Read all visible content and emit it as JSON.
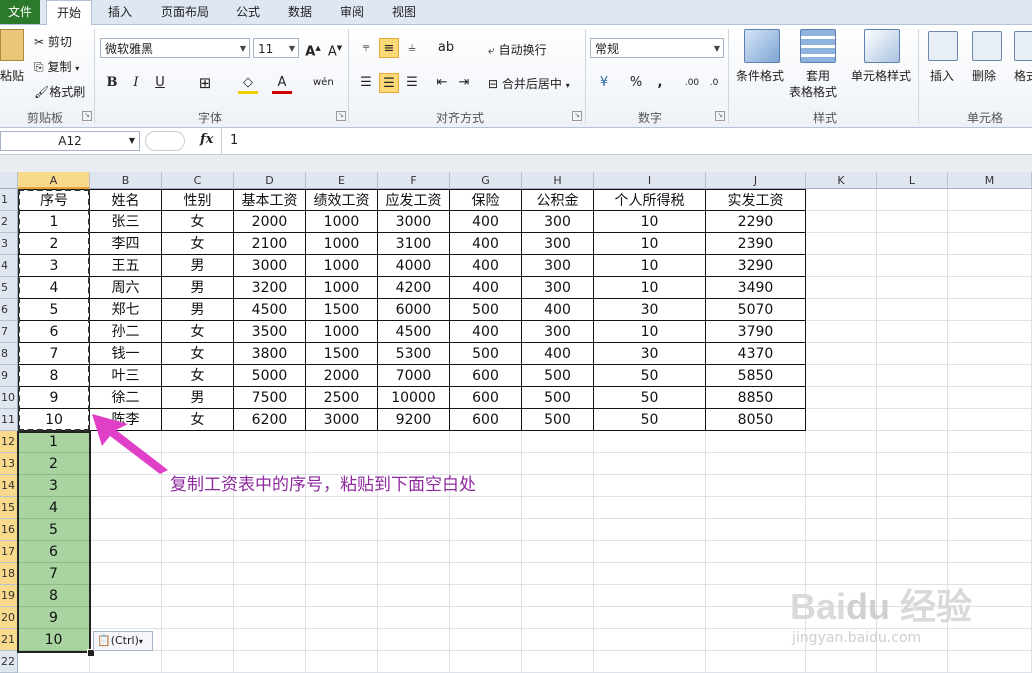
{
  "tabs": [
    "文件",
    "开始",
    "插入",
    "页面布局",
    "公式",
    "数据",
    "审阅",
    "视图"
  ],
  "active_tab": "开始",
  "ribbon": {
    "clipboard": {
      "paste": "粘贴",
      "cut": "剪切",
      "copy": "复制",
      "format_painter": "格式刷",
      "label": "剪贴板"
    },
    "font": {
      "name": "微软雅黑",
      "size": "11",
      "bold": "B",
      "italic": "I",
      "underline": "U",
      "wen": "wén",
      "label": "字体"
    },
    "alignment": {
      "wrap": "自动换行",
      "merge": "合并后居中",
      "label": "对齐方式"
    },
    "number": {
      "format": "常规",
      "percent": "%",
      "comma": ",",
      "label": "数字"
    },
    "styles": {
      "conditional": "条件格式",
      "table_l1": "套用",
      "table_l2": "表格格式",
      "cell_styles": "单元格样式",
      "label": "样式"
    },
    "cells": {
      "insert": "插入",
      "delete": "删除",
      "format": "格式",
      "label": "单元格"
    }
  },
  "formula_bar": {
    "name_box": "A12",
    "fx": "fx",
    "value": "1"
  },
  "columns": [
    "A",
    "B",
    "C",
    "D",
    "E",
    "F",
    "G",
    "H",
    "I",
    "J",
    "K",
    "L",
    "M"
  ],
  "rows": [
    "1",
    "2",
    "3",
    "4",
    "5",
    "6",
    "7",
    "8",
    "9",
    "10",
    "11",
    "12",
    "13",
    "14",
    "15",
    "16",
    "17",
    "18",
    "19",
    "20",
    "21",
    "22"
  ],
  "table": {
    "headers": [
      "序号",
      "姓名",
      "性别",
      "基本工资",
      "绩效工资",
      "应发工资",
      "保险",
      "公积金",
      "个人所得税",
      "实发工资"
    ],
    "rows": [
      [
        "1",
        "张三",
        "女",
        "2000",
        "1000",
        "3000",
        "400",
        "300",
        "10",
        "2290"
      ],
      [
        "2",
        "李四",
        "女",
        "2100",
        "1000",
        "3100",
        "400",
        "300",
        "10",
        "2390"
      ],
      [
        "3",
        "王五",
        "男",
        "3000",
        "1000",
        "4000",
        "400",
        "300",
        "10",
        "3290"
      ],
      [
        "4",
        "周六",
        "男",
        "3200",
        "1000",
        "4200",
        "400",
        "300",
        "10",
        "3490"
      ],
      [
        "5",
        "郑七",
        "男",
        "4500",
        "1500",
        "6000",
        "500",
        "400",
        "30",
        "5070"
      ],
      [
        "6",
        "孙二",
        "女",
        "3500",
        "1000",
        "4500",
        "400",
        "300",
        "10",
        "3790"
      ],
      [
        "7",
        "钱一",
        "女",
        "3800",
        "1500",
        "5300",
        "500",
        "400",
        "30",
        "4370"
      ],
      [
        "8",
        "叶三",
        "女",
        "5000",
        "2000",
        "7000",
        "600",
        "500",
        "50",
        "5850"
      ],
      [
        "9",
        "徐二",
        "男",
        "7500",
        "2500",
        "10000",
        "600",
        "500",
        "50",
        "8850"
      ],
      [
        "10",
        "陈李",
        "女",
        "6200",
        "3000",
        "9200",
        "600",
        "500",
        "50",
        "8050"
      ]
    ]
  },
  "pasted": [
    "1",
    "2",
    "3",
    "4",
    "5",
    "6",
    "7",
    "8",
    "9",
    "10"
  ],
  "paste_options": "(Ctrl)",
  "annotation": "复制工资表中的序号，粘贴到下面空白处",
  "colors": {
    "accent": "#2b7a2b",
    "paste_fill": "#a9d3a0",
    "annotation": "#8e2a9e"
  }
}
